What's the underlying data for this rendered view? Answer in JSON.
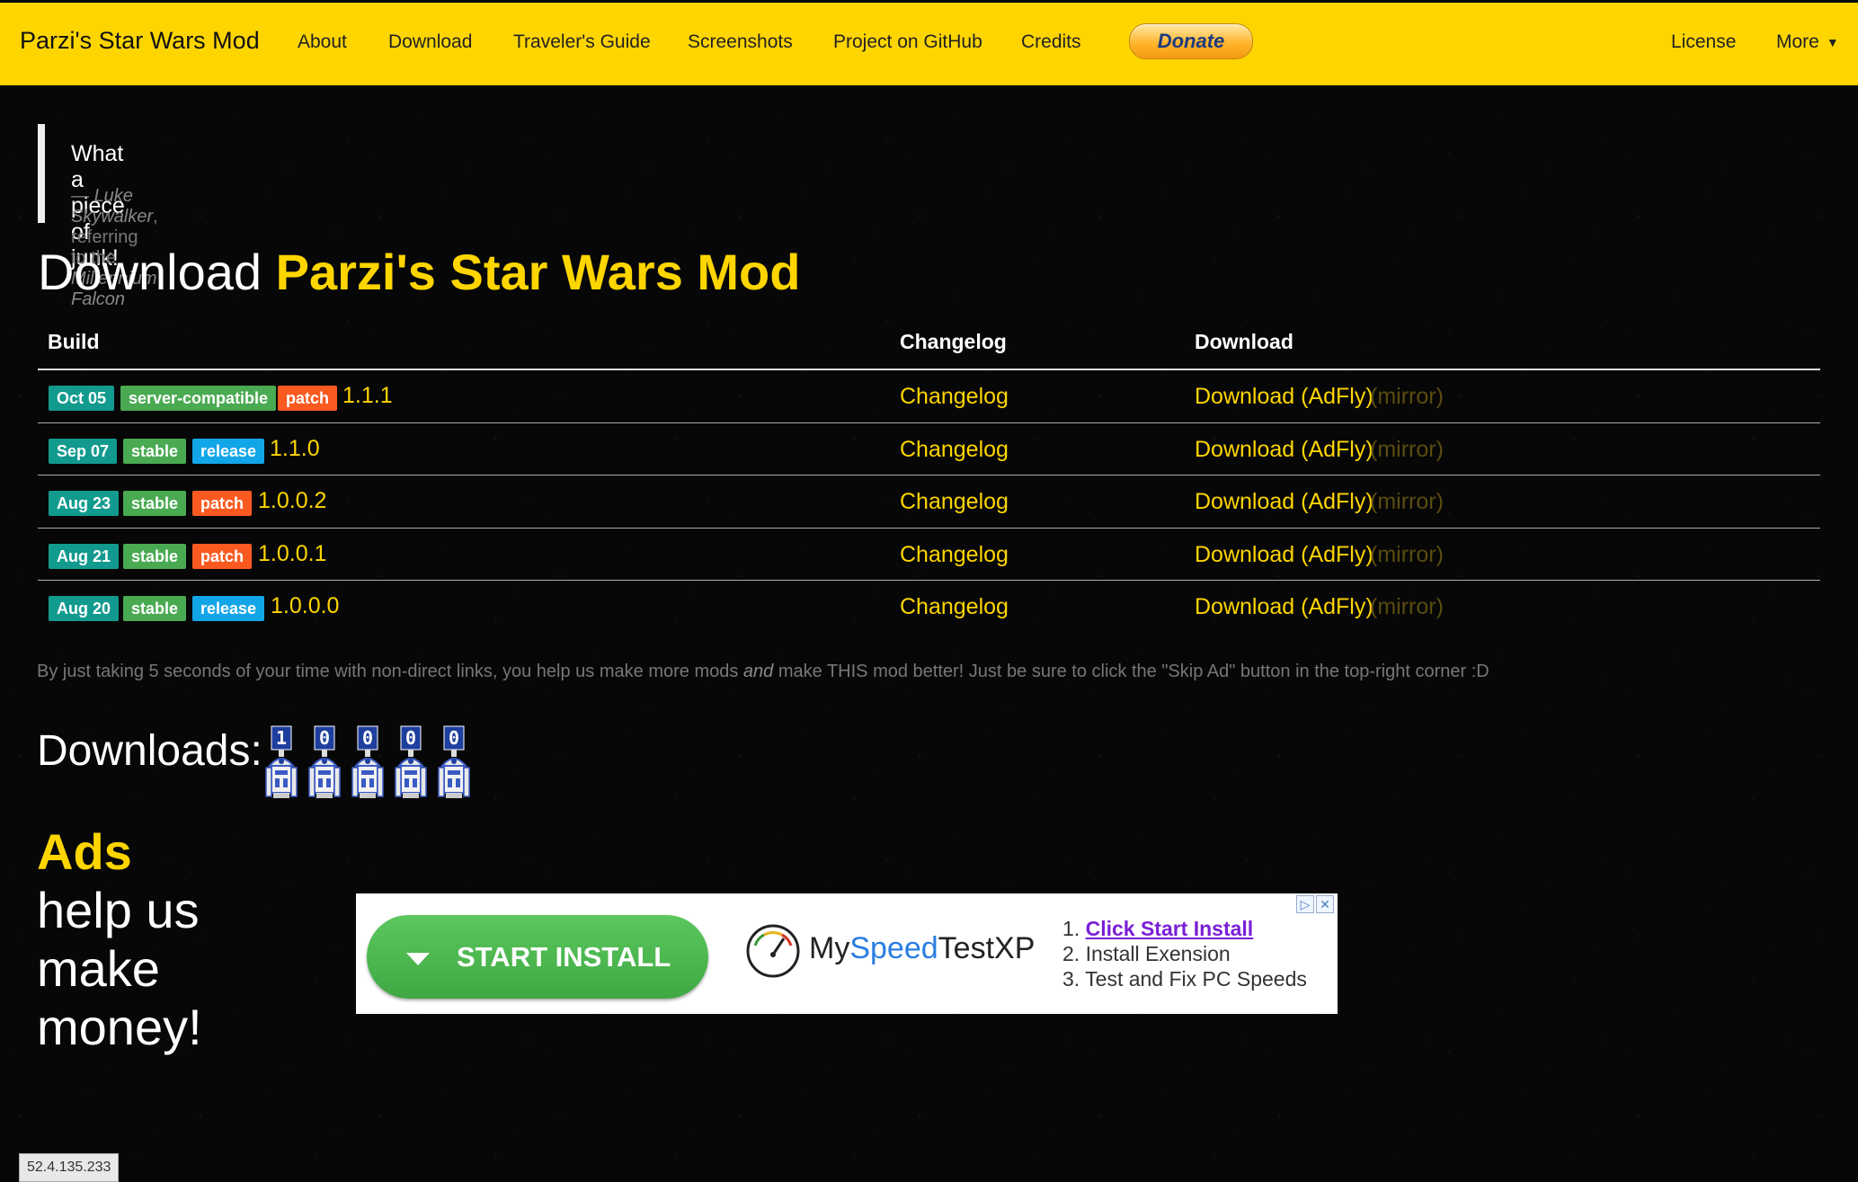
{
  "nav": {
    "brand": "Parzi's Star Wars Mod",
    "links": [
      "About",
      "Download",
      "Traveler's Guide",
      "Screenshots",
      "Project on GitHub",
      "Credits"
    ],
    "donate": "Donate",
    "license": "License",
    "more": "More"
  },
  "quote": {
    "text": "What a piece of junk!",
    "dash": "— ",
    "speaker": "Luke Skywalker",
    "middle": ", referring to the ",
    "subject": "Millennium Falcon"
  },
  "title": {
    "prefix": "Download ",
    "highlight": "Parzi's Star Wars Mod"
  },
  "table": {
    "headers": {
      "build": "Build",
      "changelog": "Changelog",
      "download": "Download"
    },
    "rows": [
      {
        "date": "Oct 05",
        "channel": "server-compatible",
        "type": "patch",
        "version": "1.1.1",
        "changelog": "Changelog",
        "download": "Download (AdFly)",
        "mirror": "(mirror)"
      },
      {
        "date": "Sep 07",
        "channel": "stable",
        "type": "release",
        "version": "1.1.0",
        "changelog": "Changelog",
        "download": "Download (AdFly)",
        "mirror": "(mirror)"
      },
      {
        "date": "Aug 23",
        "channel": "stable",
        "type": "patch",
        "version": "1.0.0.2",
        "changelog": "Changelog",
        "download": "Download (AdFly)",
        "mirror": "(mirror)"
      },
      {
        "date": "Aug 21",
        "channel": "stable",
        "type": "patch",
        "version": "1.0.0.1",
        "changelog": "Changelog",
        "download": "Download (AdFly)",
        "mirror": "(mirror)"
      },
      {
        "date": "Aug 20",
        "channel": "stable",
        "type": "release",
        "version": "1.0.0.0",
        "changelog": "Changelog",
        "download": "Download (AdFly)",
        "mirror": "(mirror)"
      }
    ]
  },
  "note": {
    "before": "By just taking 5 seconds of your time with non-direct links, you help us make more mods ",
    "emph": "and",
    "after": " make THIS mod better! Just be sure to click the \"Skip Ad\" button in the top-right corner :D"
  },
  "downloads": {
    "label": "Downloads:",
    "digits": [
      "1",
      "0",
      "0",
      "0",
      "0"
    ]
  },
  "ads_heading": {
    "highlight": "Ads",
    "rest": " help us make money!"
  },
  "ad": {
    "button": "START INSTALL",
    "brand_a": "My",
    "brand_b": "Speed",
    "brand_c": "TestXP",
    "step1_num": "1. ",
    "step1": "Click Start Install",
    "step2": "2. Install Exension",
    "step3": "3. Test and Fix PC Speeds"
  },
  "status": "52.4.135.233",
  "colors": {
    "accent": "#ffd500",
    "teal": "#129a8e",
    "green": "#4aaa52",
    "orange": "#fa5a20",
    "blue": "#12a6e8"
  }
}
